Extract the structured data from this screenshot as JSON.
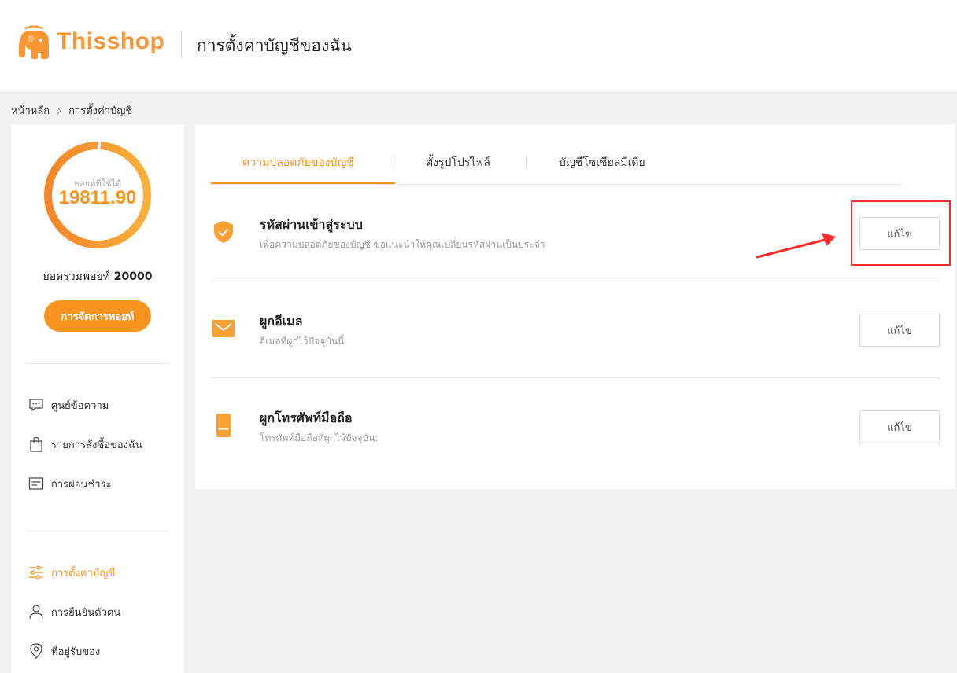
{
  "header": {
    "logo_text": "Thisshop",
    "page_title": "การตั้งค่าบัญชีของฉัน"
  },
  "breadcrumb": {
    "home": "หน้าหลัก",
    "current": "การตั้งค่าบัญชี"
  },
  "sidebar": {
    "points_label": "พอยท์ที่ใช้ได้",
    "points_value": "19811.90",
    "points_used_fraction": 0.0095,
    "total_label": "ยอดรวมพอยท์",
    "total_value": "20000",
    "manage_button": "การจัดการพอยท์",
    "menu_group_1": [
      {
        "label": "ศูนย์ข้อความ",
        "icon": "message-icon"
      },
      {
        "label": "รายการสั่งซื้อของฉัน",
        "icon": "shopping-bag-icon"
      },
      {
        "label": "การผ่อนชำระ",
        "icon": "installment-icon"
      }
    ],
    "menu_group_2": [
      {
        "label": "การตั้งค่าบัญชี",
        "icon": "settings-sliders-icon",
        "active": true
      },
      {
        "label": "การยืนยันตัวตน",
        "icon": "user-icon"
      },
      {
        "label": "ที่อยู่รับของ",
        "icon": "location-pin-icon"
      }
    ]
  },
  "tabs": [
    {
      "label": "ความปลอดภัยของบัญชี",
      "active": true
    },
    {
      "label": "ตั้งรูปโปรไฟล์",
      "active": false
    },
    {
      "label": "บัญชีโซเชียลมีเดีย",
      "active": false
    }
  ],
  "settings": [
    {
      "title": "รหัสผ่านเข้าสู่ระบบ",
      "description": "เพื่อความปลอดภัยของบัญชี ขอแนะนำให้คุณเปลี่ยนรหัสผ่านเป็นประจำ",
      "icon": "shield-check-icon",
      "button": "แก้ไข"
    },
    {
      "title": "ผูกอีเมล",
      "description": "อีเมลที่ผูกไว้ปัจจุบันนี้",
      "icon": "envelope-icon",
      "button": "แก้ไข"
    },
    {
      "title": "ผูกโทรศัพท์มือถือ",
      "description": "โทรศัพท์มือถือที่ผูกไว้ปัจจุบัน:",
      "icon": "mobile-phone-icon",
      "button": "แก้ไข"
    }
  ],
  "colors": {
    "accent": "#f7931e",
    "annotation": "#ff2a2a"
  }
}
